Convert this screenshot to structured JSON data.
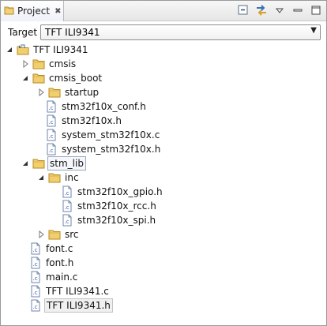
{
  "view": {
    "title": "Project",
    "close_glyph": "✖",
    "icon": "project-folder-icon",
    "toolbar": [
      "minimize-icon",
      "link-with-editor-icon",
      "view-menu-icon",
      "minimize-view-icon",
      "maximize-view-icon"
    ]
  },
  "target": {
    "label": "Target",
    "value": "TFT ILI9341",
    "arrow": "▼"
  },
  "tree": [
    {
      "label": "TFT ILI9341",
      "type": "project",
      "expanded": true
    },
    {
      "label": "cmsis",
      "type": "folder",
      "expanded": false
    },
    {
      "label": "cmsis_boot",
      "type": "folder",
      "expanded": true
    },
    {
      "label": "startup",
      "type": "folder",
      "expanded": false
    },
    {
      "label": "stm32f10x_conf.h",
      "type": "file"
    },
    {
      "label": "stm32f10x.h",
      "type": "file"
    },
    {
      "label": "system_stm32f10x.c",
      "type": "file"
    },
    {
      "label": "system_stm32f10x.h",
      "type": "file"
    },
    {
      "label": "stm_lib",
      "type": "folder",
      "expanded": true
    },
    {
      "label": "inc",
      "type": "folder",
      "expanded": true
    },
    {
      "label": "stm32f10x_gpio.h",
      "type": "file"
    },
    {
      "label": "stm32f10x_rcc.h",
      "type": "file"
    },
    {
      "label": "stm32f10x_spi.h",
      "type": "file"
    },
    {
      "label": "src",
      "type": "folder",
      "expanded": false
    },
    {
      "label": "font.c",
      "type": "file"
    },
    {
      "label": "font.h",
      "type": "file"
    },
    {
      "label": "main.c",
      "type": "file"
    },
    {
      "label": "TFT ILI9341.c",
      "type": "file"
    },
    {
      "label": "TFT ILI9341.h",
      "type": "file"
    }
  ]
}
